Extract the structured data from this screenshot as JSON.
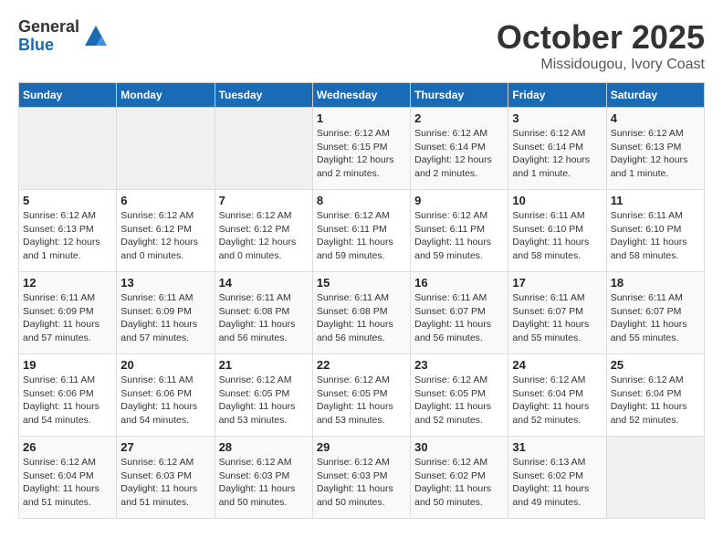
{
  "header": {
    "logo_general": "General",
    "logo_blue": "Blue",
    "month": "October 2025",
    "location": "Missidougou, Ivory Coast"
  },
  "weekdays": [
    "Sunday",
    "Monday",
    "Tuesday",
    "Wednesday",
    "Thursday",
    "Friday",
    "Saturday"
  ],
  "weeks": [
    [
      {
        "day": "",
        "info": ""
      },
      {
        "day": "",
        "info": ""
      },
      {
        "day": "",
        "info": ""
      },
      {
        "day": "1",
        "info": "Sunrise: 6:12 AM\nSunset: 6:15 PM\nDaylight: 12 hours\nand 2 minutes."
      },
      {
        "day": "2",
        "info": "Sunrise: 6:12 AM\nSunset: 6:14 PM\nDaylight: 12 hours\nand 2 minutes."
      },
      {
        "day": "3",
        "info": "Sunrise: 6:12 AM\nSunset: 6:14 PM\nDaylight: 12 hours\nand 1 minute."
      },
      {
        "day": "4",
        "info": "Sunrise: 6:12 AM\nSunset: 6:13 PM\nDaylight: 12 hours\nand 1 minute."
      }
    ],
    [
      {
        "day": "5",
        "info": "Sunrise: 6:12 AM\nSunset: 6:13 PM\nDaylight: 12 hours\nand 1 minute."
      },
      {
        "day": "6",
        "info": "Sunrise: 6:12 AM\nSunset: 6:12 PM\nDaylight: 12 hours\nand 0 minutes."
      },
      {
        "day": "7",
        "info": "Sunrise: 6:12 AM\nSunset: 6:12 PM\nDaylight: 12 hours\nand 0 minutes."
      },
      {
        "day": "8",
        "info": "Sunrise: 6:12 AM\nSunset: 6:11 PM\nDaylight: 11 hours\nand 59 minutes."
      },
      {
        "day": "9",
        "info": "Sunrise: 6:12 AM\nSunset: 6:11 PM\nDaylight: 11 hours\nand 59 minutes."
      },
      {
        "day": "10",
        "info": "Sunrise: 6:11 AM\nSunset: 6:10 PM\nDaylight: 11 hours\nand 58 minutes."
      },
      {
        "day": "11",
        "info": "Sunrise: 6:11 AM\nSunset: 6:10 PM\nDaylight: 11 hours\nand 58 minutes."
      }
    ],
    [
      {
        "day": "12",
        "info": "Sunrise: 6:11 AM\nSunset: 6:09 PM\nDaylight: 11 hours\nand 57 minutes."
      },
      {
        "day": "13",
        "info": "Sunrise: 6:11 AM\nSunset: 6:09 PM\nDaylight: 11 hours\nand 57 minutes."
      },
      {
        "day": "14",
        "info": "Sunrise: 6:11 AM\nSunset: 6:08 PM\nDaylight: 11 hours\nand 56 minutes."
      },
      {
        "day": "15",
        "info": "Sunrise: 6:11 AM\nSunset: 6:08 PM\nDaylight: 11 hours\nand 56 minutes."
      },
      {
        "day": "16",
        "info": "Sunrise: 6:11 AM\nSunset: 6:07 PM\nDaylight: 11 hours\nand 56 minutes."
      },
      {
        "day": "17",
        "info": "Sunrise: 6:11 AM\nSunset: 6:07 PM\nDaylight: 11 hours\nand 55 minutes."
      },
      {
        "day": "18",
        "info": "Sunrise: 6:11 AM\nSunset: 6:07 PM\nDaylight: 11 hours\nand 55 minutes."
      }
    ],
    [
      {
        "day": "19",
        "info": "Sunrise: 6:11 AM\nSunset: 6:06 PM\nDaylight: 11 hours\nand 54 minutes."
      },
      {
        "day": "20",
        "info": "Sunrise: 6:11 AM\nSunset: 6:06 PM\nDaylight: 11 hours\nand 54 minutes."
      },
      {
        "day": "21",
        "info": "Sunrise: 6:12 AM\nSunset: 6:05 PM\nDaylight: 11 hours\nand 53 minutes."
      },
      {
        "day": "22",
        "info": "Sunrise: 6:12 AM\nSunset: 6:05 PM\nDaylight: 11 hours\nand 53 minutes."
      },
      {
        "day": "23",
        "info": "Sunrise: 6:12 AM\nSunset: 6:05 PM\nDaylight: 11 hours\nand 52 minutes."
      },
      {
        "day": "24",
        "info": "Sunrise: 6:12 AM\nSunset: 6:04 PM\nDaylight: 11 hours\nand 52 minutes."
      },
      {
        "day": "25",
        "info": "Sunrise: 6:12 AM\nSunset: 6:04 PM\nDaylight: 11 hours\nand 52 minutes."
      }
    ],
    [
      {
        "day": "26",
        "info": "Sunrise: 6:12 AM\nSunset: 6:04 PM\nDaylight: 11 hours\nand 51 minutes."
      },
      {
        "day": "27",
        "info": "Sunrise: 6:12 AM\nSunset: 6:03 PM\nDaylight: 11 hours\nand 51 minutes."
      },
      {
        "day": "28",
        "info": "Sunrise: 6:12 AM\nSunset: 6:03 PM\nDaylight: 11 hours\nand 50 minutes."
      },
      {
        "day": "29",
        "info": "Sunrise: 6:12 AM\nSunset: 6:03 PM\nDaylight: 11 hours\nand 50 minutes."
      },
      {
        "day": "30",
        "info": "Sunrise: 6:12 AM\nSunset: 6:02 PM\nDaylight: 11 hours\nand 50 minutes."
      },
      {
        "day": "31",
        "info": "Sunrise: 6:13 AM\nSunset: 6:02 PM\nDaylight: 11 hours\nand 49 minutes."
      },
      {
        "day": "",
        "info": ""
      }
    ]
  ]
}
